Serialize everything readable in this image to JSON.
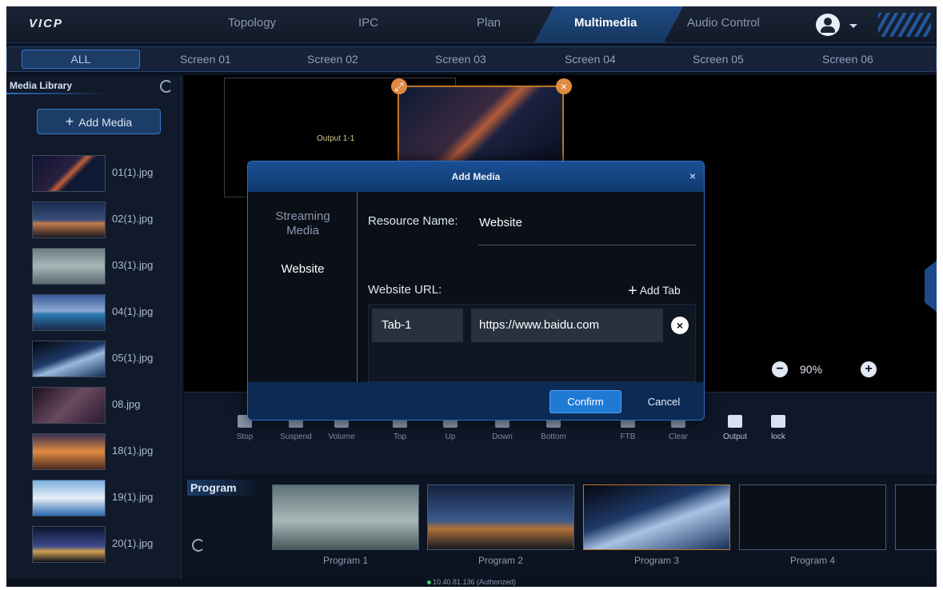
{
  "app": {
    "logo": "VICP"
  },
  "nav": {
    "items": [
      {
        "label": "Topology"
      },
      {
        "label": "IPC"
      },
      {
        "label": "Plan"
      },
      {
        "label": "Multimedia"
      },
      {
        "label": "Audio Control"
      }
    ],
    "active": "Multimedia"
  },
  "screens": {
    "tabs": [
      {
        "label": "ALL"
      },
      {
        "label": "Screen 01"
      },
      {
        "label": "Screen 02"
      },
      {
        "label": "Screen 03"
      },
      {
        "label": "Screen 04"
      },
      {
        "label": "Screen 05"
      },
      {
        "label": "Screen 06"
      }
    ],
    "active": "ALL"
  },
  "library": {
    "title": "Media Library",
    "add_label": "Add Media",
    "items": [
      {
        "name": "01(1).jpg"
      },
      {
        "name": "02(1).jpg"
      },
      {
        "name": "03(1).jpg"
      },
      {
        "name": "04(1).jpg"
      },
      {
        "name": "05(1).jpg"
      },
      {
        "name": "08.jpg"
      },
      {
        "name": "18(1).jpg"
      },
      {
        "name": "19(1).jpg"
      },
      {
        "name": "20(1).jpg"
      }
    ]
  },
  "canvas": {
    "output_label": "Output 1-1",
    "zoom": "90%"
  },
  "toolbar": {
    "items": [
      {
        "label": "Stop",
        "icon": "stop-icon"
      },
      {
        "label": "Suspend",
        "icon": "pause-icon"
      },
      {
        "label": "Volume",
        "icon": "volume-icon"
      },
      {
        "label": "Top",
        "icon": "top-icon"
      },
      {
        "label": "Up",
        "icon": "up-icon"
      },
      {
        "label": "Down",
        "icon": "down-icon"
      },
      {
        "label": "Bottom",
        "icon": "bottom-icon"
      },
      {
        "label": "FTB",
        "icon": "ftb-icon"
      },
      {
        "label": "Clear",
        "icon": "clear-icon"
      },
      {
        "label": "Output",
        "icon": "output-icon"
      },
      {
        "label": "lock",
        "icon": "lock-icon"
      }
    ]
  },
  "program": {
    "title": "Program",
    "items": [
      {
        "label": "Program 1"
      },
      {
        "label": "Program 2"
      },
      {
        "label": "Program 3"
      },
      {
        "label": "Program 4"
      }
    ],
    "selected": "Program 3"
  },
  "status": {
    "text": "10.40.81.136 (Authorized)"
  },
  "dialog": {
    "title": "Add Media",
    "close": "×",
    "sidebar": [
      {
        "label": "Streaming Media"
      },
      {
        "label": "Website"
      }
    ],
    "active_type": "Website",
    "resource_name_label": "Resource Name:",
    "resource_name_value": "Website",
    "url_label": "Website URL:",
    "add_tab_label": "Add Tab",
    "tabs": [
      {
        "name": "Tab-1",
        "url": "https://www.baidu.com"
      }
    ],
    "confirm_label": "Confirm",
    "cancel_label": "Cancel"
  },
  "colors": {
    "accent": "#1f7ad6",
    "selection_border": "#c0762a",
    "status_online": "#3fcf6a"
  }
}
